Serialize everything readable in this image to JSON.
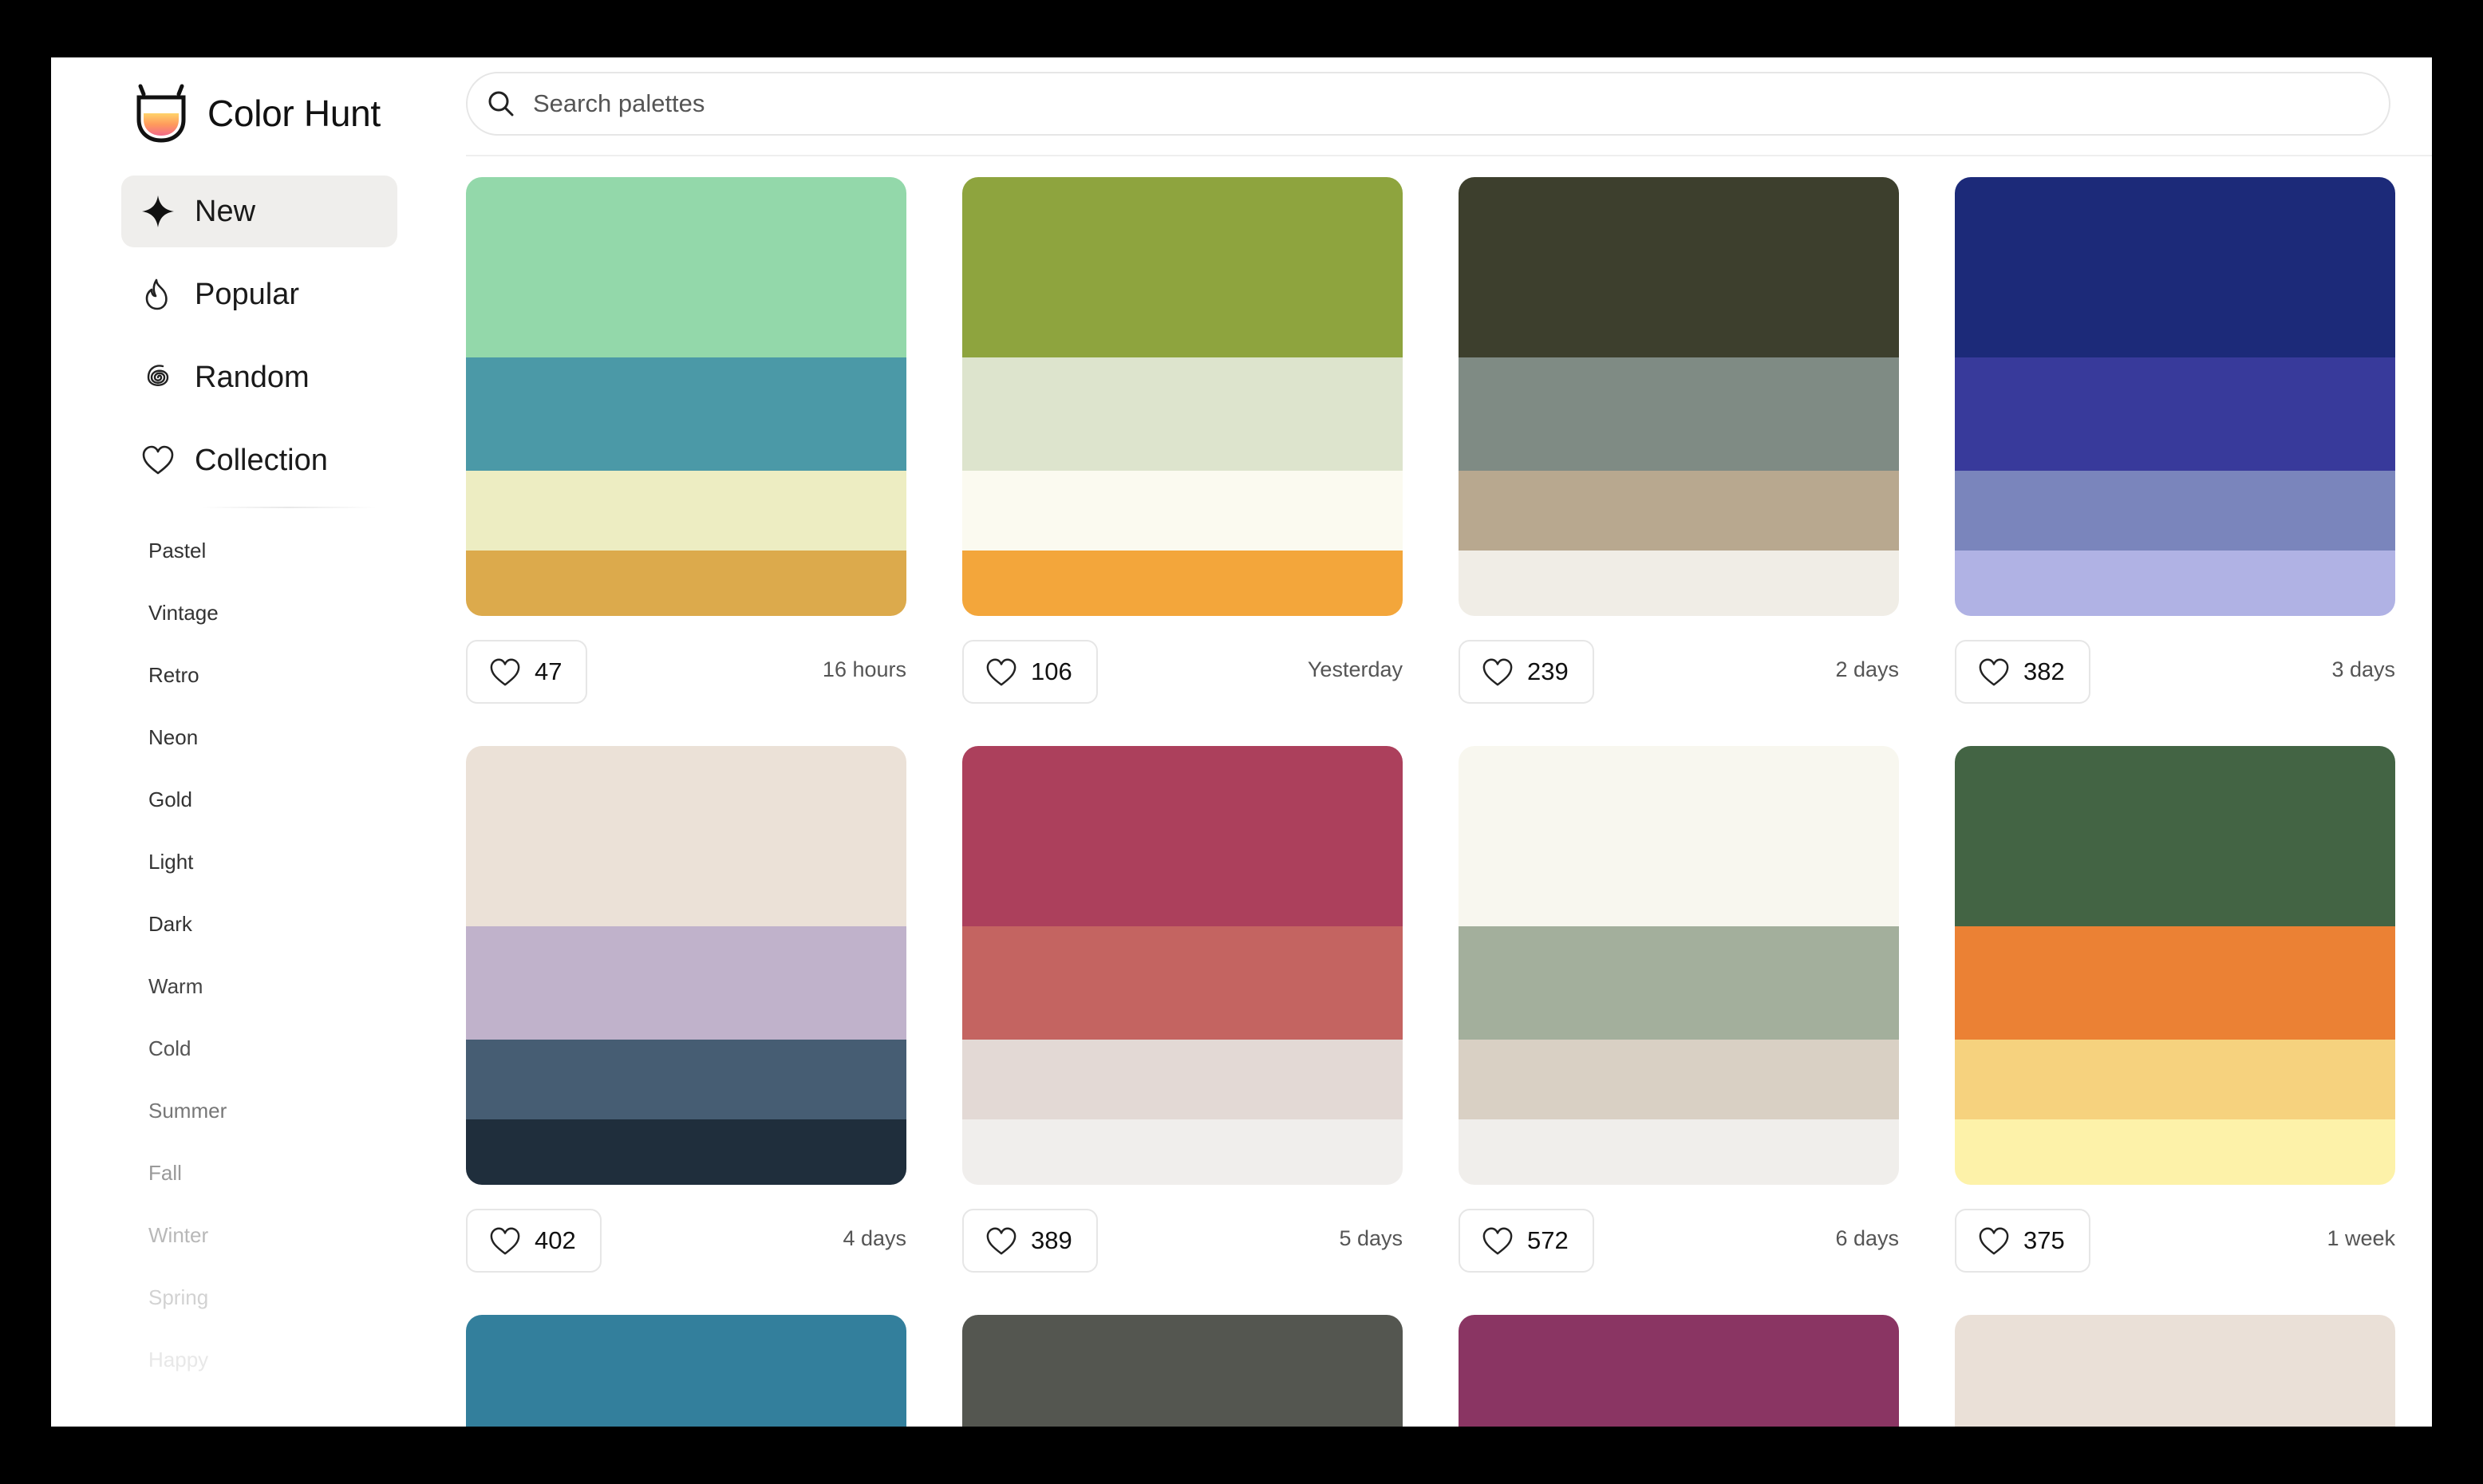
{
  "app": {
    "name": "Color Hunt"
  },
  "search": {
    "placeholder": "Search palettes",
    "value": ""
  },
  "nav": [
    {
      "label": "New",
      "icon": "sparkle-icon",
      "active": true
    },
    {
      "label": "Popular",
      "icon": "flame-icon",
      "active": false
    },
    {
      "label": "Random",
      "icon": "spiral-icon",
      "active": false
    },
    {
      "label": "Collection",
      "icon": "heart-outline-icon",
      "active": false
    }
  ],
  "tags": [
    {
      "label": "Pastel",
      "color": "#333333"
    },
    {
      "label": "Vintage",
      "color": "#333333"
    },
    {
      "label": "Retro",
      "color": "#333333"
    },
    {
      "label": "Neon",
      "color": "#333333"
    },
    {
      "label": "Gold",
      "color": "#333333"
    },
    {
      "label": "Light",
      "color": "#333333"
    },
    {
      "label": "Dark",
      "color": "#333333"
    },
    {
      "label": "Warm",
      "color": "#444444"
    },
    {
      "label": "Cold",
      "color": "#555555"
    },
    {
      "label": "Summer",
      "color": "#777777"
    },
    {
      "label": "Fall",
      "color": "#999999"
    },
    {
      "label": "Winter",
      "color": "#b8b8b8"
    },
    {
      "label": "Spring",
      "color": "#d2d2d2"
    },
    {
      "label": "Happy",
      "color": "#e8e8e8"
    }
  ],
  "palettes": [
    {
      "colors": [
        "#93d8aa",
        "#4b99a7",
        "#ededc2",
        "#dcaa4c"
      ],
      "likes": "47",
      "date": "16 hours"
    },
    {
      "colors": [
        "#8ea43e",
        "#dde4cd",
        "#fbfaf0",
        "#f3a63b"
      ],
      "likes": "106",
      "date": "Yesterday"
    },
    {
      "colors": [
        "#3d3f2d",
        "#7f8b84",
        "#b8a88f",
        "#f0ede6"
      ],
      "likes": "239",
      "date": "2 days"
    },
    {
      "colors": [
        "#1c2a79",
        "#383a9b",
        "#7a85bc",
        "#b0b2e4"
      ],
      "likes": "382",
      "date": "3 days"
    },
    {
      "colors": [
        "#ebe1d7",
        "#c0b2cb",
        "#465d73",
        "#1f2e3c"
      ],
      "likes": "402",
      "date": "4 days"
    },
    {
      "colors": [
        "#ac405c",
        "#c46461",
        "#e3d9d5",
        "#f0eeec"
      ],
      "likes": "389",
      "date": "5 days"
    },
    {
      "colors": [
        "#f8f7ef",
        "#a3af9c",
        "#d9d0c4",
        "#f0eeeb"
      ],
      "likes": "572",
      "date": "6 days"
    },
    {
      "colors": [
        "#436444",
        "#eb8134",
        "#f6d27e",
        "#fdf2a9"
      ],
      "likes": "375",
      "date": "1 week"
    }
  ],
  "partial_palettes": [
    {
      "colors": [
        "#337f9c"
      ]
    },
    {
      "colors": [
        "#545650"
      ]
    },
    {
      "colors": [
        "#8a3563"
      ]
    },
    {
      "colors": [
        "#eae0d7"
      ]
    }
  ]
}
